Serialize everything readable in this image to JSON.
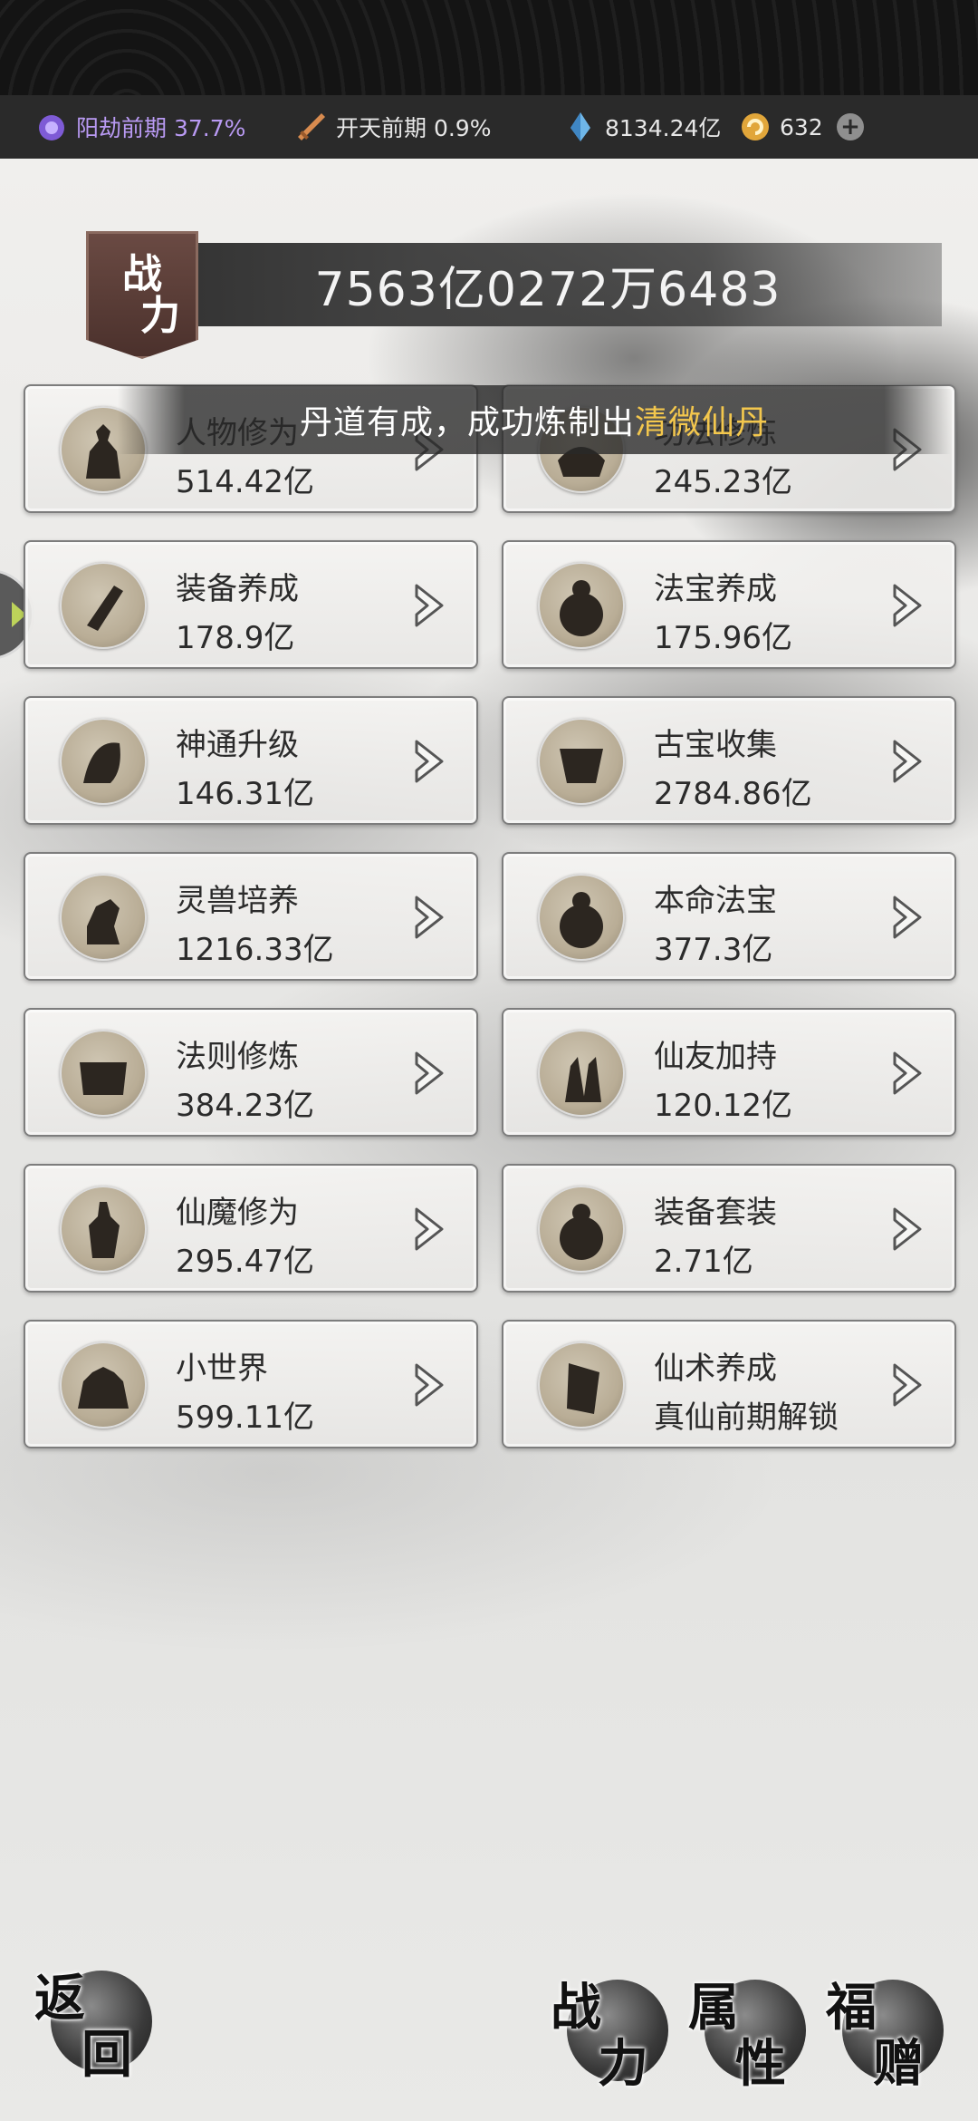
{
  "status_bar": {
    "realm_text": "阳劫前期 37.7%",
    "realm2_text": "开天前期 0.9%",
    "crystal_text": "8134.24亿",
    "coin_text": "632"
  },
  "power": {
    "badge": [
      "战",
      "力"
    ],
    "value": "7563亿0272万6483"
  },
  "toast": {
    "prefix": "丹道有成，成功炼制出",
    "highlight": "清微仙丹"
  },
  "cards": [
    {
      "name": "人物修为",
      "value": "514.42亿"
    },
    {
      "name": "功法修炼",
      "value": "245.23亿"
    },
    {
      "name": "装备养成",
      "value": "178.9亿"
    },
    {
      "name": "法宝养成",
      "value": "175.96亿"
    },
    {
      "name": "神通升级",
      "value": "146.31亿"
    },
    {
      "name": "古宝收集",
      "value": "2784.86亿"
    },
    {
      "name": "灵兽培养",
      "value": "1216.33亿"
    },
    {
      "name": "本命法宝",
      "value": "377.3亿"
    },
    {
      "name": "法则修炼",
      "value": "384.23亿"
    },
    {
      "name": "仙友加持",
      "value": "120.12亿"
    },
    {
      "name": "仙魔修为",
      "value": "295.47亿"
    },
    {
      "name": "装备套装",
      "value": "2.71亿"
    },
    {
      "name": "小世界",
      "value": "599.11亿"
    },
    {
      "name": "仙术养成",
      "value": "真仙前期解锁"
    }
  ],
  "bottom": {
    "back": [
      "返",
      "回"
    ],
    "power": [
      "战",
      "力"
    ],
    "attr": [
      "属",
      "性"
    ],
    "gift": [
      "福",
      "赠"
    ]
  },
  "colors": {
    "accent_gold": "#f3c74d",
    "realm_purple": "#b99af3",
    "badge_brown": "#5b3d37"
  }
}
